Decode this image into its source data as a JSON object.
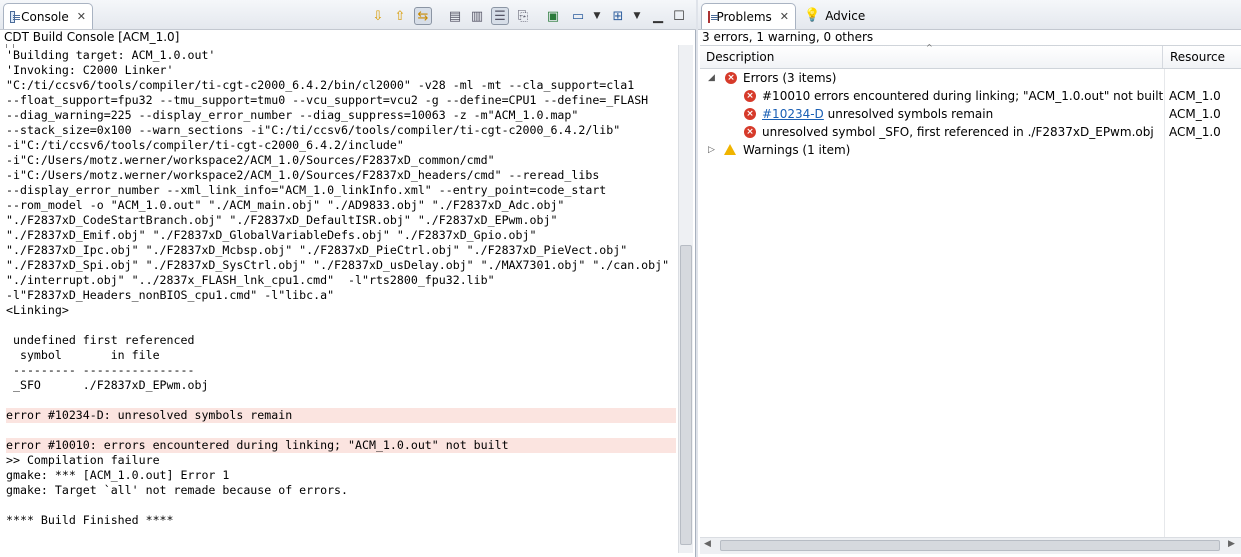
{
  "console": {
    "tab_label": "Console",
    "subtitle": "CDT Build Console [ACM_1.0]",
    "lines": [
      "'Building target: ACM_1.0.out'",
      "'Invoking: C2000 Linker'",
      "\"C:/ti/ccsv6/tools/compiler/ti-cgt-c2000_6.4.2/bin/cl2000\" -v28 -ml -mt --cla_support=cla1",
      "--float_support=fpu32 --tmu_support=tmu0 --vcu_support=vcu2 -g --define=CPU1 --define=_FLASH",
      "--diag_warning=225 --display_error_number --diag_suppress=10063 -z -m\"ACM_1.0.map\"",
      "--stack_size=0x100 --warn_sections -i\"C:/ti/ccsv6/tools/compiler/ti-cgt-c2000_6.4.2/lib\"",
      "-i\"C:/ti/ccsv6/tools/compiler/ti-cgt-c2000_6.4.2/include\"",
      "-i\"C:/Users/motz.werner/workspace2/ACM_1.0/Sources/F2837xD_common/cmd\"",
      "-i\"C:/Users/motz.werner/workspace2/ACM_1.0/Sources/F2837xD_headers/cmd\" --reread_libs",
      "--display_error_number --xml_link_info=\"ACM_1.0_linkInfo.xml\" --entry_point=code_start",
      "--rom_model -o \"ACM_1.0.out\" \"./ACM_main.obj\" \"./AD9833.obj\" \"./F2837xD_Adc.obj\"",
      "\"./F2837xD_CodeStartBranch.obj\" \"./F2837xD_DefaultISR.obj\" \"./F2837xD_EPwm.obj\"",
      "\"./F2837xD_Emif.obj\" \"./F2837xD_GlobalVariableDefs.obj\" \"./F2837xD_Gpio.obj\"",
      "\"./F2837xD_Ipc.obj\" \"./F2837xD_Mcbsp.obj\" \"./F2837xD_PieCtrl.obj\" \"./F2837xD_PieVect.obj\"",
      "\"./F2837xD_Spi.obj\" \"./F2837xD_SysCtrl.obj\" \"./F2837xD_usDelay.obj\" \"./MAX7301.obj\" \"./can.obj\"",
      "\"./interrupt.obj\" \"../2837x_FLASH_lnk_cpu1.cmd\"  -l\"rts2800_fpu32.lib\"",
      "-l\"F2837xD_Headers_nonBIOS_cpu1.cmd\" -l\"libc.a\"",
      "<Linking>",
      "",
      " undefined first referenced",
      "  symbol       in file",
      " --------- ----------------",
      " _SFO      ./F2837xD_EPwm.obj",
      "",
      "error #10234-D: unresolved symbols remain",
      "",
      "error #10010: errors encountered during linking; \"ACM_1.0.out\" not built",
      ">> Compilation failure",
      "gmake: *** [ACM_1.0.out] Error 1",
      "gmake: Target `all' not remade because of errors.",
      "",
      "**** Build Finished ****"
    ],
    "error_line_indexes": [
      24,
      26
    ]
  },
  "problems": {
    "tab_label": "Problems",
    "advice_tab_label": "Advice",
    "summary": "3 errors, 1 warning, 0 others",
    "columns": {
      "description": "Description",
      "resource": "Resource"
    },
    "errors_group": "Errors (3 items)",
    "errors": [
      {
        "code": "",
        "description": "#10010 errors encountered during linking; \"ACM_1.0.out\" not built",
        "resource": "ACM_1.0"
      },
      {
        "code": "#10234-D",
        "description": "unresolved symbols remain",
        "resource": "ACM_1.0"
      },
      {
        "code": "",
        "description": "unresolved symbol _SFO, first referenced in ./F2837xD_EPwm.obj",
        "resource": "ACM_1.0"
      }
    ],
    "warnings_group": "Warnings (1 item)"
  },
  "colors": {
    "error_line_bg": "#fbe4e0",
    "error_icon": "#d63a2a",
    "warning_icon": "#f0b400",
    "link": "#1a5fb4"
  }
}
